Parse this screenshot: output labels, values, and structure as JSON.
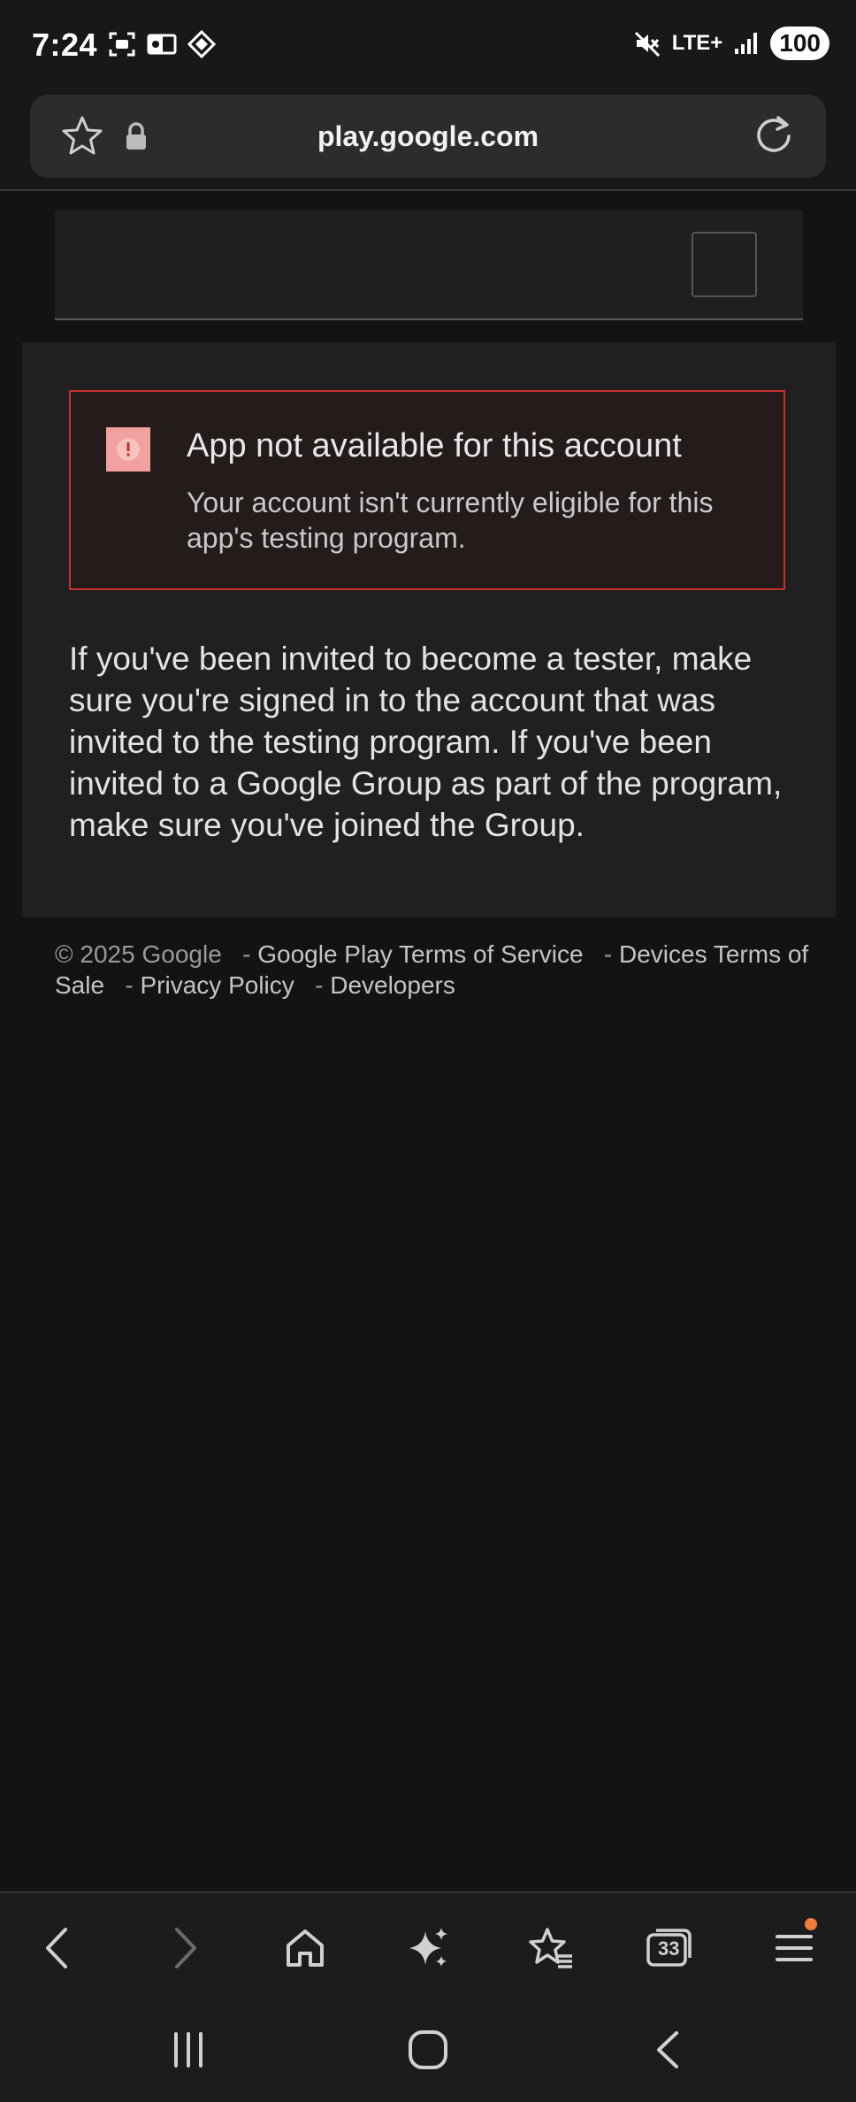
{
  "status_bar": {
    "time": "7:24",
    "network": "LTE+",
    "battery": "100",
    "icons": [
      "screenshot-icon",
      "outlook-icon",
      "pattern-icon",
      "mute-icon",
      "signal-icon"
    ]
  },
  "browser": {
    "url": "play.google.com",
    "tabs_count": "33",
    "icons": [
      "star-icon",
      "lock-icon",
      "reload-icon"
    ]
  },
  "alert": {
    "title": "App not available for this account",
    "body": "Your account isn't currently eligible for this app's testing program.",
    "color": "#c5302e"
  },
  "info": {
    "text": "If you've been invited to become a tester, make sure you're signed in to the account that was invited to the testing program. If you've been invited to a Google Group as part of the program, make sure you've joined the Group."
  },
  "footer": {
    "copyright": "© 2025 Google",
    "links": [
      "Google Play Terms of Service",
      "Devices Terms of Sale",
      "Privacy Policy",
      "Developers"
    ]
  },
  "toolbar": {
    "items": [
      "back-icon",
      "forward-icon",
      "home-icon",
      "ai-sparkle-icon",
      "bookmarks-icon",
      "tabs-icon",
      "menu-icon"
    ],
    "accent": "#f07b3a"
  }
}
